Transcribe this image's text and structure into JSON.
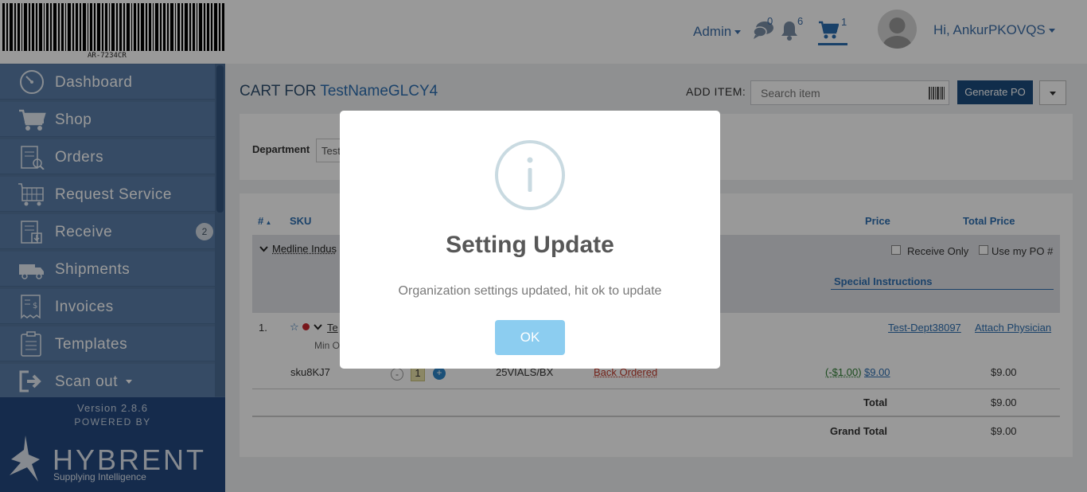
{
  "header": {
    "barcode_text": "AR-7234CR",
    "admin_label": "Admin",
    "messages_count": "0",
    "notifications_count": "6",
    "cart_count": "1",
    "user_greeting": "Hi, AnkurPKOVQS"
  },
  "sidebar": {
    "items": [
      {
        "label": "Dashboard",
        "icon": "dashboard-icon"
      },
      {
        "label": "Shop",
        "icon": "cart-icon"
      },
      {
        "label": "Orders",
        "icon": "orders-icon"
      },
      {
        "label": "Request Service",
        "icon": "request-service-icon"
      },
      {
        "label": "Receive",
        "icon": "receive-icon",
        "badge": "2"
      },
      {
        "label": "Shipments",
        "icon": "truck-icon"
      },
      {
        "label": "Invoices",
        "icon": "invoice-icon"
      },
      {
        "label": "Templates",
        "icon": "clipboard-icon"
      },
      {
        "label": "Scan out",
        "icon": "scan-out-icon"
      }
    ],
    "version": "Version 2.8.6",
    "powered_by": "POWERED BY",
    "brand_name": "HYBRENT",
    "brand_tagline": "Supplying Intelligence"
  },
  "main": {
    "cart_title_prefix": "CART FOR",
    "cart_name": "TestNameGLCY4",
    "add_item_label": "ADD ITEM:",
    "search_placeholder": "Search item",
    "generate_po": "Generate PO",
    "department_label": "Department",
    "department_value": "Test"
  },
  "table": {
    "headers": {
      "num": "#",
      "sku": "SKU",
      "price": "Price",
      "total_price": "Total Price"
    },
    "vendor_name": "Medline Indus",
    "receive_only": "Receive Only",
    "use_my_po": "Use my PO #",
    "special_instructions": "Special Instructions",
    "row": {
      "index": "1.",
      "item_name": "Te",
      "min_order": "Min O",
      "dept_link": "Test-Dept38097",
      "attach_physician": "Attach Physician",
      "sku": "sku8KJ7",
      "qty": "1",
      "qty_minus": "-",
      "qty_plus": "+",
      "pack": "25VIALS/BX",
      "status": "Back Ordered",
      "discount": "(-$1.00)",
      "price": "$9.00",
      "total": "$9.00"
    },
    "total_label": "Total",
    "total_value": "$9.00",
    "grand_total_label": "Grand Total",
    "grand_total_value": "$9.00"
  },
  "modal": {
    "title": "Setting Update",
    "message": "Organization settings updated, hit ok to update",
    "ok_label": "OK"
  },
  "colors": {
    "sidebar": "#5a7ea8",
    "sidebar_footer": "#23497f",
    "primary_button": "#1c4c7d",
    "link": "#2d6fb1",
    "ok_button": "#8ccdf0"
  }
}
